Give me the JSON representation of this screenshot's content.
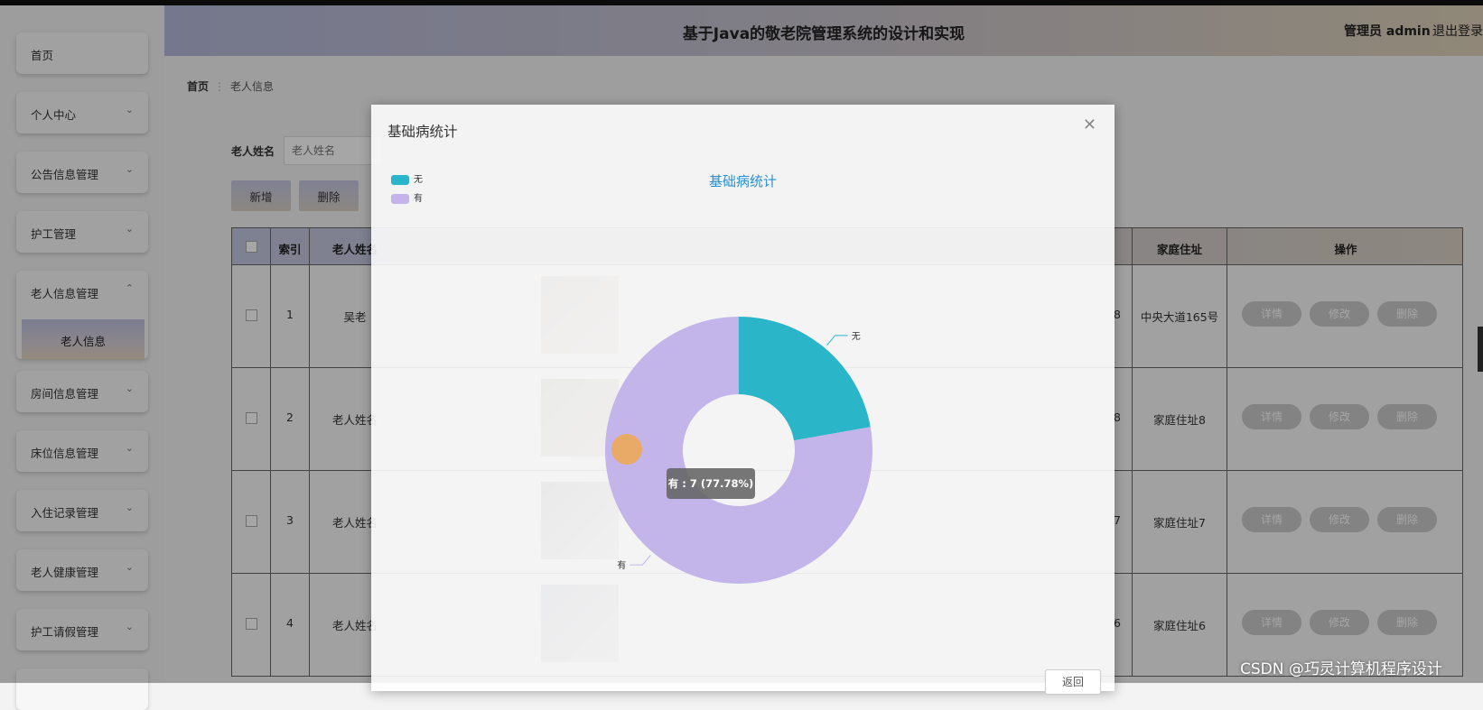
{
  "app": {
    "title": "基于Java的敬老院管理系统的设计和实现",
    "admin_label": "管理员 admin",
    "logout_label": "退出登录"
  },
  "sidebar": {
    "items": [
      {
        "label": "首页",
        "chevron": ""
      },
      {
        "label": "个人中心",
        "chevron": "⌄"
      },
      {
        "label": "公告信息管理",
        "chevron": "⌄"
      },
      {
        "label": "护工管理",
        "chevron": "⌄"
      },
      {
        "label": "老人信息管理",
        "chevron": "⌃"
      },
      {
        "label": "房间信息管理",
        "chevron": "⌄"
      },
      {
        "label": "床位信息管理",
        "chevron": "⌄"
      },
      {
        "label": "入住记录管理",
        "chevron": "⌄"
      },
      {
        "label": "老人健康管理",
        "chevron": "⌄"
      },
      {
        "label": "护工请假管理",
        "chevron": "⌄"
      }
    ],
    "sub_item": "老人信息"
  },
  "breadcrumb": {
    "home": "首页",
    "separator": "⋮",
    "current": "老人信息"
  },
  "search": {
    "label": "老人姓名",
    "placeholder": "老人姓名"
  },
  "toolbar": {
    "add": "新增",
    "delete": "删除"
  },
  "table": {
    "headers": [
      "索引",
      "老人姓名",
      "家庭住址",
      "操作"
    ],
    "rows": [
      {
        "index": "1",
        "name": "吴老",
        "address": "中央大道165号",
        "phone_tail": "8"
      },
      {
        "index": "2",
        "name": "老人姓名",
        "address": "家庭住址8",
        "phone_tail": "8"
      },
      {
        "index": "3",
        "name": "老人姓名",
        "address": "家庭住址7",
        "phone_tail": "7"
      },
      {
        "index": "4",
        "name": "老人姓名",
        "address": "家庭住址6",
        "phone_tail": "6"
      }
    ],
    "actions": [
      "详情",
      "修改",
      "删除"
    ]
  },
  "dialog": {
    "title": "基础病统计",
    "close_icon": "close-icon",
    "return_label": "返回"
  },
  "chart_data": {
    "type": "pie",
    "title": "基础病统计",
    "categories": [
      "无",
      "有"
    ],
    "values": [
      2,
      7
    ],
    "colors": [
      "#2bb5c8",
      "#c3b4ea"
    ],
    "legend": [
      "无",
      "有"
    ],
    "legend_position": "top-left",
    "tooltip": "有 : 7 (77.78%)"
  },
  "watermark": "CSDN @巧灵计算机程序设计"
}
